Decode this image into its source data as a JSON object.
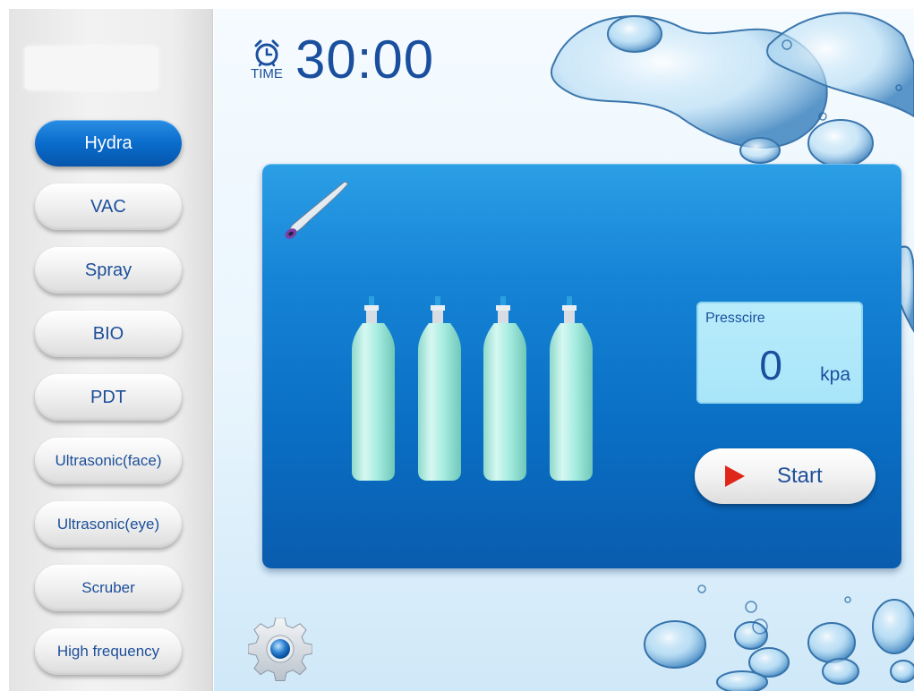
{
  "sidebar": {
    "modes": [
      {
        "label": "Hydra",
        "active": true
      },
      {
        "label": "VAC",
        "active": false
      },
      {
        "label": "Spray",
        "active": false
      },
      {
        "label": "BIO",
        "active": false
      },
      {
        "label": "PDT",
        "active": false
      },
      {
        "label": "Ultrasonic(face)",
        "active": false
      },
      {
        "label": "Ultrasonic(eye)",
        "active": false
      },
      {
        "label": "Scruber",
        "active": false
      },
      {
        "label": "High frequency",
        "active": false
      }
    ]
  },
  "timer": {
    "label": "TIME",
    "value": "30:00",
    "icon": "alarm-clock-icon"
  },
  "panel": {
    "handpiece_icon": "hydra-wand-icon",
    "bottle_count": 4,
    "pressure": {
      "label": "Presscire",
      "value": "0",
      "unit": "kpa"
    },
    "start_button": {
      "label": "Start",
      "icon": "play-icon"
    }
  },
  "settings": {
    "icon": "gear-icon"
  },
  "colors": {
    "accent": "#0a6ccc",
    "text_blue": "#1a4f9e",
    "play_red": "#e0261b",
    "bottle": "#a6ece0"
  }
}
